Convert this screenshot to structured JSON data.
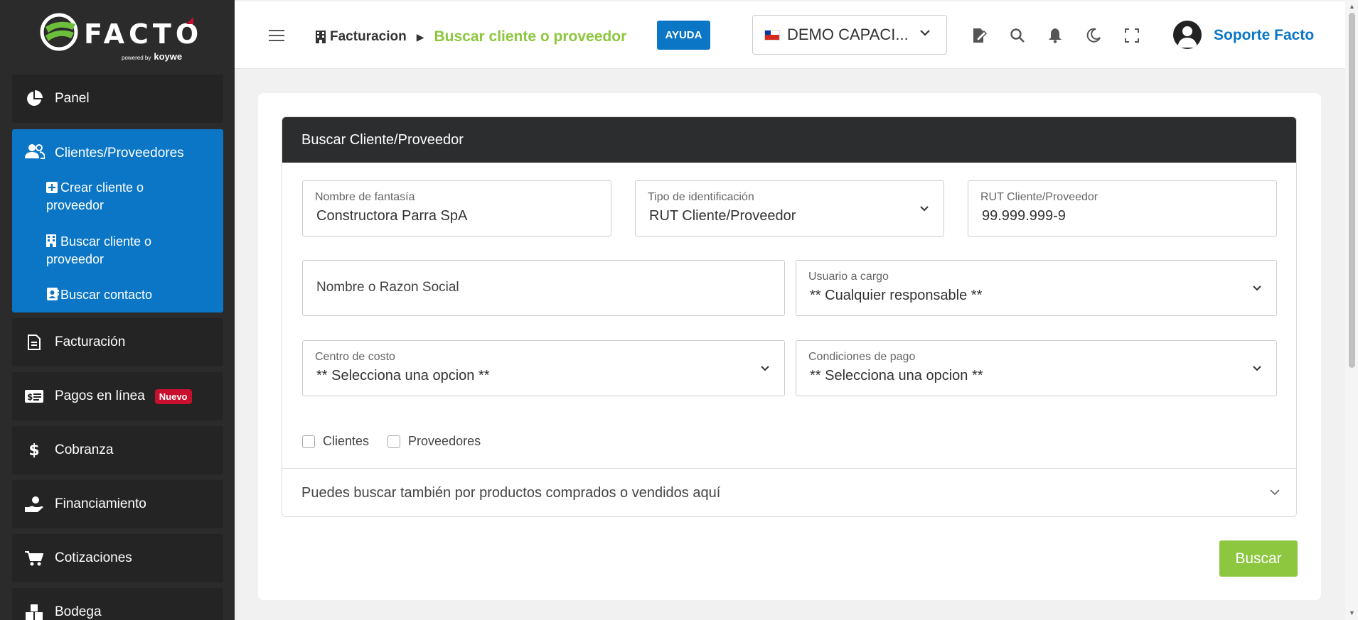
{
  "sidebar": {
    "logo_text": "FACTO",
    "logo_sub_small": "powered by",
    "logo_sub": "koywe",
    "items": [
      {
        "label": "Panel",
        "icon": "pie-chart-icon"
      },
      {
        "label": "Clientes/Proveedores",
        "icon": "users-icon"
      },
      {
        "label": "Facturación",
        "icon": "document-icon"
      },
      {
        "label": "Pagos en línea",
        "icon": "payment-card-icon",
        "badge": "Nuevo"
      },
      {
        "label": "Cobranza",
        "icon": "dollar-icon"
      },
      {
        "label": "Financiamiento",
        "icon": "hand-money-icon"
      },
      {
        "label": "Cotizaciones",
        "icon": "cart-icon"
      },
      {
        "label": "Bodega",
        "icon": "boxes-icon"
      }
    ],
    "subitems": [
      {
        "label_line1": "Crear cliente o",
        "label_line2": "proveedor",
        "icon": "plus-square-icon"
      },
      {
        "label_line1": "Buscar cliente o",
        "label_line2": "proveedor",
        "icon": "building-icon"
      },
      {
        "label_line1": "Buscar contacto",
        "label_line2": "",
        "icon": "contact-card-icon"
      }
    ]
  },
  "topbar": {
    "breadcrumb_root": "Facturacion",
    "breadcrumb_current": "Buscar cliente o proveedor",
    "help_label": "AYUDA",
    "company": "DEMO CAPACI...",
    "user_name": "Soporte Facto"
  },
  "form": {
    "panel_title": "Buscar Cliente/Proveedor",
    "fantasy_name": {
      "label": "Nombre de fantasía",
      "value": "Constructora Parra SpA"
    },
    "id_type": {
      "label": "Tipo de identificación",
      "value": "RUT Cliente/Proveedor"
    },
    "rut": {
      "label": "RUT Cliente/Proveedor",
      "value": "99.999.999-9"
    },
    "business_name": {
      "placeholder": "Nombre o Razon Social"
    },
    "user_in_charge": {
      "label": "Usuario a cargo",
      "value": "** Cualquier responsable **"
    },
    "cost_center": {
      "label": "Centro de costo",
      "value": "** Selecciona una opcion **"
    },
    "payment_terms": {
      "label": "Condiciones de pago",
      "value": "** Selecciona una opcion **"
    },
    "check_clients": "Clientes",
    "check_suppliers": "Proveedores",
    "products_collapse": "Puedes buscar también por productos comprados o vendidos aquí",
    "search_button": "Buscar"
  },
  "colors": {
    "sidebar_bg": "#2b2b2b",
    "active_blue": "#0b76c5",
    "accent_green": "#8dc63f",
    "badge_red": "#c8102e",
    "panel_header": "#2c2d2f"
  }
}
